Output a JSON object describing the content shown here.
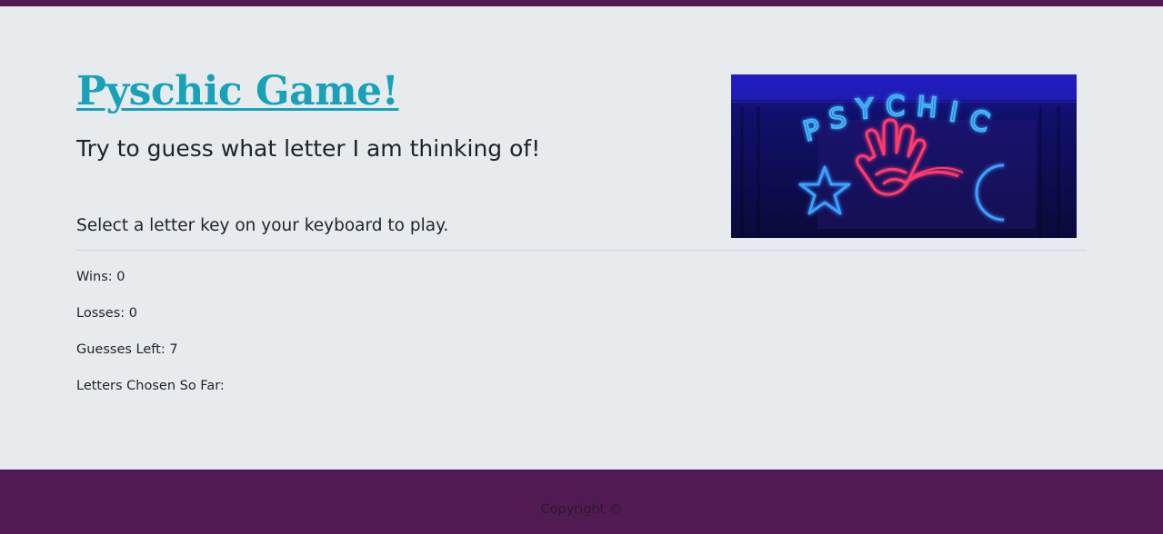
{
  "header": {
    "title": "Pyschic Game!",
    "subtitle": "Try to guess what letter I am thinking of!",
    "instruction": "Select a letter key on your keyboard to play.",
    "image": {
      "text": "PSYCHIC",
      "icons": [
        "hand-icon",
        "star-icon",
        "crescent-moon-icon"
      ]
    }
  },
  "stats": {
    "wins": "Wins: 0",
    "losses": "Losses: 0",
    "guesses_left": "Guesses Left: 7",
    "letters_chosen": "Letters Chosen So Far:"
  },
  "footer": {
    "copyright": "Copyright ©"
  },
  "colors": {
    "brand_purple": "#521a52",
    "title_teal": "#17a2b8",
    "background": "#e8ebee",
    "neon_blue": "#3aa0ff",
    "neon_pink": "#ff3b6b"
  }
}
